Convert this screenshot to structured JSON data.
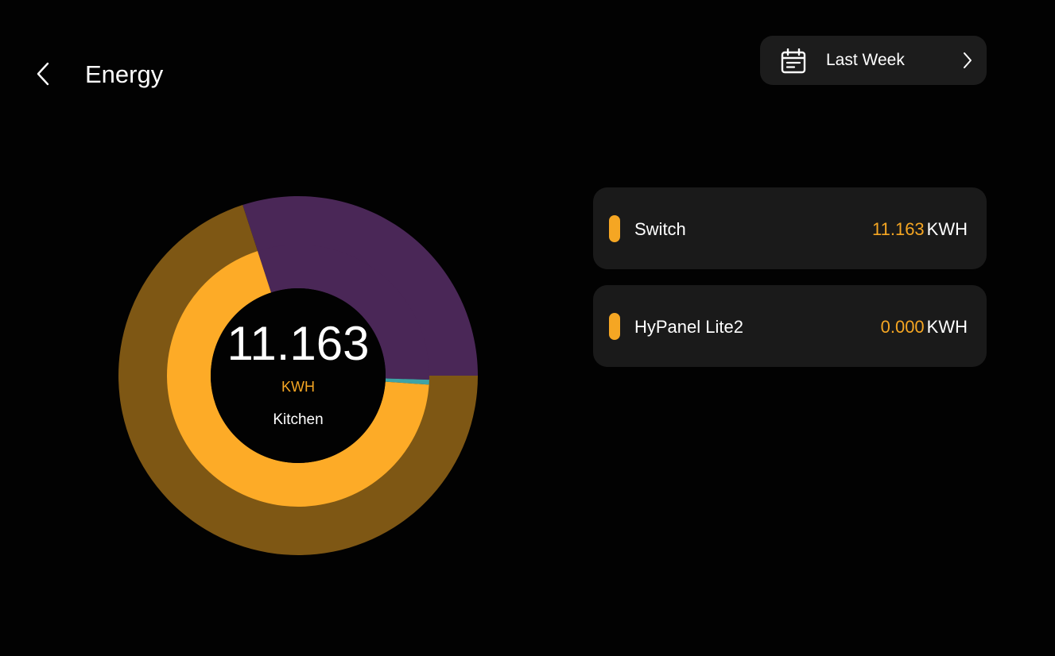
{
  "header": {
    "title": "Energy",
    "back_icon": "chevron-left-icon"
  },
  "date_filter": {
    "label": "Last Week",
    "icon": "calendar-icon",
    "chevron_icon": "chevron-right-icon"
  },
  "summary": {
    "total_value": "11.163",
    "unit": "KWH",
    "room": "Kitchen"
  },
  "devices": [
    {
      "name": "Switch",
      "value": "11.163",
      "unit": "KWH",
      "color": "#f5a623"
    },
    {
      "name": "HyPanel Lite2",
      "value": "0.000",
      "unit": "KWH",
      "color": "#f5a623"
    }
  ],
  "chart_data": {
    "type": "donut",
    "rings": [
      {
        "ring": "outer",
        "segments": [
          {
            "fraction": 0.3,
            "color": "#4a2757"
          },
          {
            "fraction": 0.7,
            "color": "#7e5714"
          }
        ]
      },
      {
        "ring": "inner",
        "segments": [
          {
            "fraction": 0.305,
            "color": "#4a2757"
          },
          {
            "fraction": 0.006,
            "color": "#3ea3a6"
          },
          {
            "fraction": 0.689,
            "color": "#fdab27"
          }
        ]
      }
    ]
  }
}
